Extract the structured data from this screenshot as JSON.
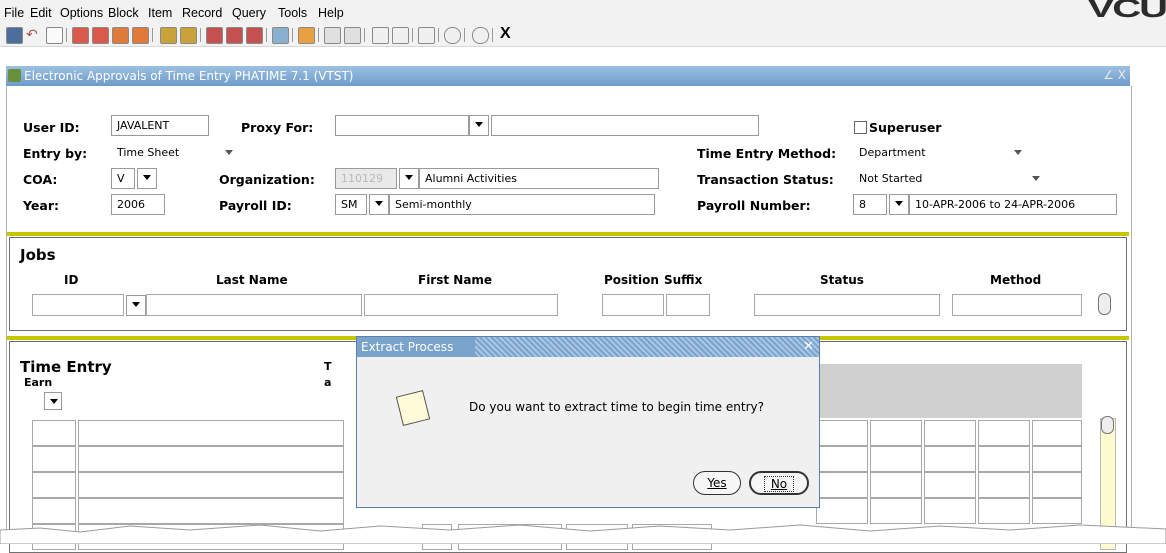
{
  "menu": [
    "File",
    "Edit",
    "Options",
    "Block",
    "Item",
    "Record",
    "Query",
    "Tools",
    "Help"
  ],
  "logo": "VCU",
  "toolbar": {
    "exit_label": "X"
  },
  "window": {
    "title": "Electronic Approvals of Time Entry  PHATIME  7.1  (VTST)",
    "controls": "∠ X"
  },
  "key_block": {
    "user_id_label": "User ID:",
    "user_id": "JAVALENT",
    "proxy_for_label": "Proxy For:",
    "superuser_label": "Superuser",
    "entry_by_label": "Entry by:",
    "entry_by": "Time Sheet",
    "time_entry_method_label": "Time Entry Method:",
    "time_entry_method": "Department",
    "coa_label": "COA:",
    "coa": "V",
    "organization_label": "Organization:",
    "organization_code": "110129",
    "organization_name": "Alumni Activities",
    "transaction_status_label": "Transaction Status:",
    "transaction_status": "Not Started",
    "year_label": "Year:",
    "year": "2006",
    "payroll_id_label": "Payroll ID:",
    "payroll_id": "SM",
    "payroll_desc": "Semi-monthly",
    "payroll_number_label": "Payroll Number:",
    "payroll_number": "8",
    "payroll_range": "10-APR-2006 to 24-APR-2006"
  },
  "jobs": {
    "title": "Jobs",
    "headers": {
      "id": "ID",
      "last": "Last Name",
      "first": "First Name",
      "position": "Position",
      "suffix": "Suffix",
      "status": "Status",
      "method": "Method"
    }
  },
  "time_entry": {
    "title": "Time Entry",
    "earn_label": "Earn",
    "partial_a": "T",
    "partial_b": "a"
  },
  "dialog": {
    "title": "Extract Process",
    "message": "Do you want to extract time to begin time entry?",
    "yes_label": "Yes",
    "no_label": "No"
  },
  "colors": {
    "gold": "#c6c600",
    "title_blue": "#6d9ccb"
  }
}
